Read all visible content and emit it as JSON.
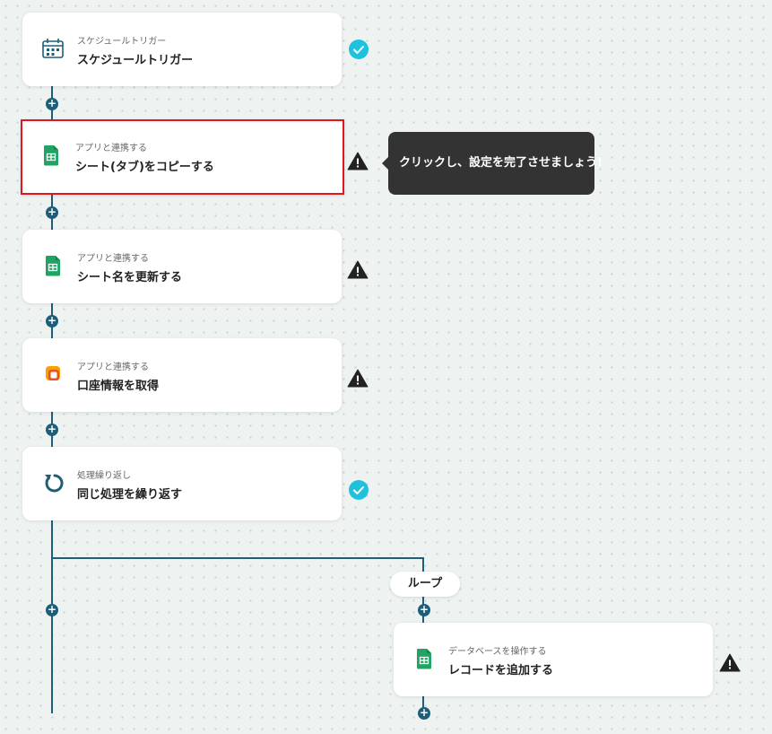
{
  "steps": [
    {
      "subtitle": "スケジュールトリガー",
      "title": "スケジュールトリガー",
      "icon": "calendar-icon",
      "status": "complete"
    },
    {
      "subtitle": "アプリと連携する",
      "title": "シート(タブ)をコピーする",
      "icon": "google-sheets-icon",
      "status": "warning"
    },
    {
      "subtitle": "アプリと連携する",
      "title": "シート名を更新する",
      "icon": "google-sheets-icon",
      "status": "warning"
    },
    {
      "subtitle": "アプリと連携する",
      "title": "口座情報を取得",
      "icon": "bank-app-icon",
      "status": "warning"
    },
    {
      "subtitle": "処理繰り返し",
      "title": "同じ処理を繰り返す",
      "icon": "loop-icon",
      "status": "complete"
    }
  ],
  "loop": {
    "label": "ループ",
    "step": {
      "subtitle": "データベースを操作する",
      "title": "レコードを追加する",
      "icon": "google-sheets-icon",
      "status": "warning"
    }
  },
  "tooltip": {
    "text": "クリックし、設定を完了させましょう!"
  },
  "colors": {
    "connector": "#1d5f78",
    "complete": "#1fc2dc",
    "warning": "#222222",
    "selected_border": "#e3161d",
    "sheets_green": "#1fa463",
    "tooltip_bg": "#333333"
  }
}
